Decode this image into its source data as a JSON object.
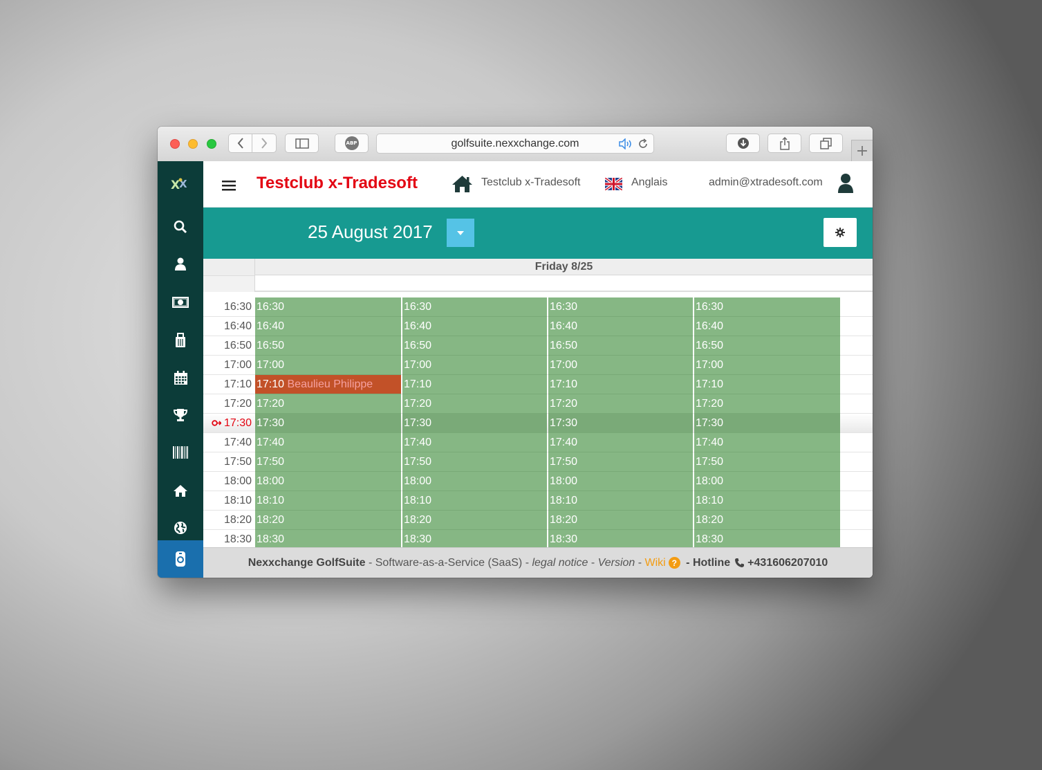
{
  "browser": {
    "url": "golfsuite.nexxchange.com",
    "adblock_label": "ABP"
  },
  "header": {
    "club_title": "Testclub x-Tradesoft",
    "club_link": "Testclub x-Tradesoft",
    "language": "Anglais",
    "user_email": "admin@xtradesoft.com"
  },
  "datebar": {
    "date": "25 August 2017"
  },
  "calendar": {
    "day_header": "Friday 8/25",
    "current_time": "17:30",
    "times": [
      "16:30",
      "16:40",
      "16:50",
      "17:00",
      "17:10",
      "17:20",
      "17:30",
      "17:40",
      "17:50",
      "18:00",
      "18:10",
      "18:20",
      "18:30"
    ],
    "booking": {
      "time": "17:10",
      "name": "Beaulieu Philippe",
      "column": 1
    }
  },
  "footer": {
    "brand": "Nexxchange GolfSuite",
    "sep1": " - ",
    "saas": "Software-as-a-Service (SaaS)",
    "sep2": " - ",
    "legal": "legal notice",
    "sep3": " - ",
    "version": "Version",
    "sep4": " - ",
    "wiki": "Wiki",
    "help": "?",
    "sep5": " - ",
    "hotline": "Hotline",
    "phone": "+431606207010"
  },
  "colors": {
    "sidebar": "#0c3c39",
    "datebar": "#179a91",
    "slot_free": "#86b784",
    "slot_booked": "#c25128",
    "title_red": "#e30613"
  },
  "icons": {
    "sidebar": [
      "logo-icon",
      "search-icon",
      "user-icon",
      "money-icon",
      "bag-icon",
      "calendar-icon",
      "trophy-icon",
      "barcode-icon",
      "home-icon",
      "globe-icon",
      "mobile-icon"
    ]
  }
}
